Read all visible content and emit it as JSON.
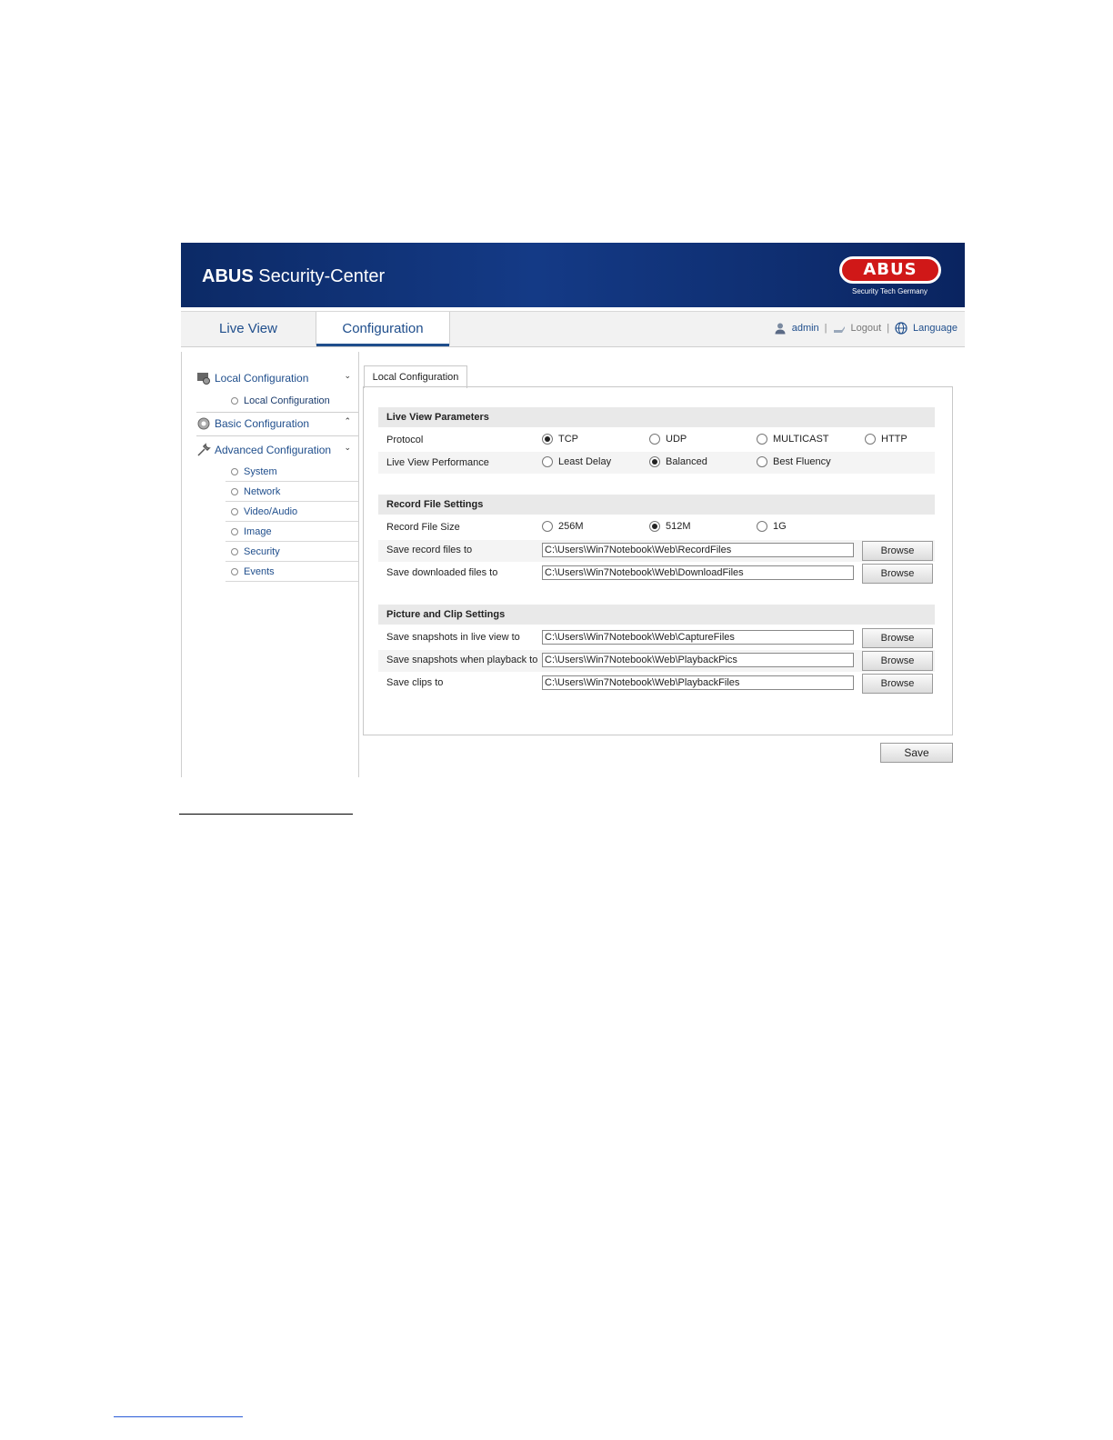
{
  "header": {
    "brand_bold": "ABUS",
    "brand_rest": " Security-Center",
    "logo_text": "ABUS",
    "logo_tagline": "Security Tech Germany"
  },
  "nav": {
    "tabs": [
      {
        "label": "Live View"
      },
      {
        "label": "Configuration"
      }
    ],
    "user": "admin",
    "logout": "Logout",
    "language": "Language",
    "separator": "|"
  },
  "sidebar": {
    "local": "Local Configuration",
    "local_sub": "Local Configuration",
    "basic": "Basic Configuration",
    "advanced": "Advanced Configuration",
    "advanced_items": [
      "System",
      "Network",
      "Video/Audio",
      "Image",
      "Security",
      "Events"
    ]
  },
  "content": {
    "tab": "Local Configuration",
    "live_view": {
      "heading": "Live View Parameters",
      "protocol_label": "Protocol",
      "protocol_options": [
        "TCP",
        "UDP",
        "MULTICAST",
        "HTTP"
      ],
      "protocol_selected": "TCP",
      "performance_label": "Live View Performance",
      "performance_options": [
        "Least Delay",
        "Balanced",
        "Best Fluency"
      ],
      "performance_selected": "Balanced"
    },
    "record": {
      "heading": "Record File Settings",
      "size_label": "Record File Size",
      "size_options": [
        "256M",
        "512M",
        "1G"
      ],
      "size_selected": "512M",
      "save_record_label": "Save record files to",
      "save_record_path": "C:\\Users\\Win7Notebook\\Web\\RecordFiles",
      "save_download_label": "Save downloaded files to",
      "save_download_path": "C:\\Users\\Win7Notebook\\Web\\DownloadFiles"
    },
    "picture": {
      "heading": "Picture and Clip Settings",
      "snap_live_label": "Save snapshots in live view to",
      "snap_live_path": "C:\\Users\\Win7Notebook\\Web\\CaptureFiles",
      "snap_playback_label": "Save snapshots when playback to",
      "snap_playback_path": "C:\\Users\\Win7Notebook\\Web\\PlaybackPics",
      "clips_label": "Save clips to",
      "clips_path": "C:\\Users\\Win7Notebook\\Web\\PlaybackFiles"
    },
    "browse_label": "Browse",
    "save_label": "Save"
  }
}
